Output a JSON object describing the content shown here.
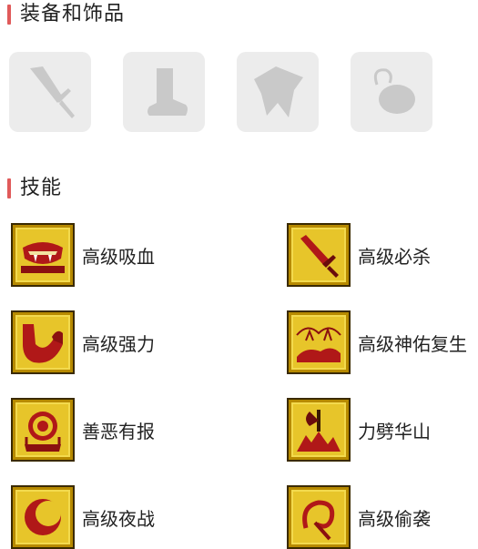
{
  "equipment_section": {
    "title": "装备和饰品",
    "slots": [
      {
        "icon": "sword-icon"
      },
      {
        "icon": "boot-icon"
      },
      {
        "icon": "cloak-icon"
      },
      {
        "icon": "amulet-icon"
      }
    ]
  },
  "skills_section": {
    "title": "技能",
    "skills": [
      {
        "name": "高级吸血",
        "icon": "vampire-mouth-icon"
      },
      {
        "name": "高级必杀",
        "icon": "critical-sword-icon"
      },
      {
        "name": "高级强力",
        "icon": "strength-arm-icon"
      },
      {
        "name": "高级神佑复生",
        "icon": "resurrection-icon"
      },
      {
        "name": "善恶有报",
        "icon": "karma-emblem-icon"
      },
      {
        "name": "力劈华山",
        "icon": "cleave-axe-icon"
      },
      {
        "name": "高级夜战",
        "icon": "night-combat-icon"
      },
      {
        "name": "高级偷袭",
        "icon": "sneak-attack-icon"
      }
    ]
  },
  "colors": {
    "accent_bar": "#e05a5a",
    "slot_background": "#ececec",
    "skill_icon_gold": "#e7c52a",
    "skill_icon_red": "#b01818"
  }
}
